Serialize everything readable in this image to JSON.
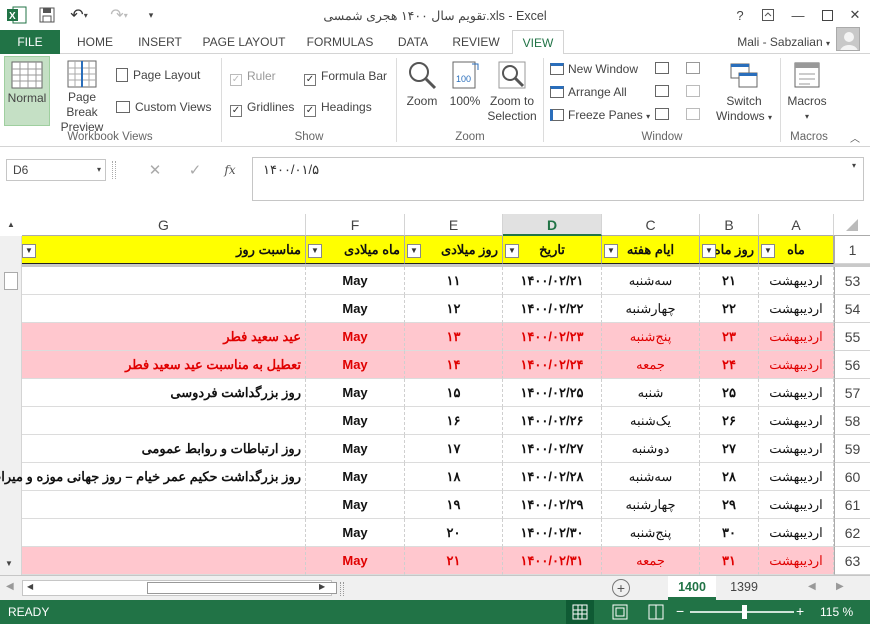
{
  "window": {
    "title": "تقویم سال ۱۴۰۰ هجری شمسی.xls - Excel",
    "help": "?",
    "minimize": "—",
    "close": "✕"
  },
  "tabs": [
    "FILE",
    "HOME",
    "INSERT",
    "PAGE LAYOUT",
    "FORMULAS",
    "DATA",
    "REVIEW",
    "VIEW"
  ],
  "active_tab": "VIEW",
  "user": "Mali - Sabzalian",
  "ribbon": {
    "workbook_views": {
      "group": "Workbook Views",
      "normal": "Normal",
      "page_break_line1": "Page Break",
      "page_break_line2": "Preview",
      "page_layout": "Page Layout",
      "custom_views": "Custom Views"
    },
    "show": {
      "group": "Show",
      "ruler": "Ruler",
      "formula_bar": "Formula Bar",
      "gridlines": "Gridlines",
      "headings": "Headings"
    },
    "zoom": {
      "group": "Zoom",
      "zoom": "Zoom",
      "hundred": "100%",
      "zoom_sel_line1": "Zoom to",
      "zoom_sel_line2": "Selection"
    },
    "window": {
      "group": "Window",
      "new_window": "New Window",
      "arrange_all": "Arrange All",
      "freeze_panes": "Freeze Panes",
      "switch_line1": "Switch",
      "switch_line2": "Windows"
    },
    "macros": {
      "group": "Macros",
      "macros": "Macros"
    }
  },
  "formula_bar": {
    "name_box": "D6",
    "fx": "fx",
    "value": "۱۴۰۰/۰۱/۵"
  },
  "columns": [
    "G",
    "F",
    "E",
    "D",
    "C",
    "B",
    "A"
  ],
  "header_row": {
    "num": "1",
    "A": "ماه",
    "B": "روز ماه",
    "C": "ایام هفته",
    "D": "تاریخ",
    "E": "روز میلادی",
    "F": "ماه میلادی",
    "G": "مناسبت روز"
  },
  "rows": [
    {
      "num": "53",
      "A": "اردیبهشت",
      "B": "۲۱",
      "C": "سه‌شنبه",
      "D": "۱۴۰۰/۰۲/۲۱",
      "E": "۱۱",
      "F": "May",
      "G": "",
      "holiday": false
    },
    {
      "num": "54",
      "A": "اردیبهشت",
      "B": "۲۲",
      "C": "چهارشنبه",
      "D": "۱۴۰۰/۰۲/۲۲",
      "E": "۱۲",
      "F": "May",
      "G": "",
      "holiday": false
    },
    {
      "num": "55",
      "A": "اردیبهشت",
      "B": "۲۳",
      "C": "پنج‌شنبه",
      "D": "۱۴۰۰/۰۲/۲۳",
      "E": "۱۳",
      "F": "May",
      "G": "عید سعید فطر",
      "holiday": true
    },
    {
      "num": "56",
      "A": "اردیبهشت",
      "B": "۲۴",
      "C": "جمعه",
      "D": "۱۴۰۰/۰۲/۲۴",
      "E": "۱۴",
      "F": "May",
      "G": "تعطیل به مناسبت عید سعید فطر",
      "holiday": true
    },
    {
      "num": "57",
      "A": "اردیبهشت",
      "B": "۲۵",
      "C": "شنبه",
      "D": "۱۴۰۰/۰۲/۲۵",
      "E": "۱۵",
      "F": "May",
      "G": "روز بزرگداشت فردوسی",
      "holiday": false
    },
    {
      "num": "58",
      "A": "اردیبهشت",
      "B": "۲۶",
      "C": "یک‌شنبه",
      "D": "۱۴۰۰/۰۲/۲۶",
      "E": "۱۶",
      "F": "May",
      "G": "",
      "holiday": false
    },
    {
      "num": "59",
      "A": "اردیبهشت",
      "B": "۲۷",
      "C": "دوشنبه",
      "D": "۱۴۰۰/۰۲/۲۷",
      "E": "۱۷",
      "F": "May",
      "G": "روز ارتباطات و روابط عمومی",
      "holiday": false
    },
    {
      "num": "60",
      "A": "اردیبهشت",
      "B": "۲۸",
      "C": "سه‌شنبه",
      "D": "۱۴۰۰/۰۲/۲۸",
      "E": "۱۸",
      "F": "May",
      "G": "روز بزرگداشت حکیم عمر خیام – روز جهانی موزه و میراث",
      "holiday": false
    },
    {
      "num": "61",
      "A": "اردیبهشت",
      "B": "۲۹",
      "C": "چهارشنبه",
      "D": "۱۴۰۰/۰۲/۲۹",
      "E": "۱۹",
      "F": "May",
      "G": "",
      "holiday": false
    },
    {
      "num": "62",
      "A": "اردیبهشت",
      "B": "۳۰",
      "C": "پنج‌شنبه",
      "D": "۱۴۰۰/۰۲/۳۰",
      "E": "۲۰",
      "F": "May",
      "G": "",
      "holiday": false
    },
    {
      "num": "63",
      "A": "اردیبهشت",
      "B": "۳۱",
      "C": "جمعه",
      "D": "۱۴۰۰/۰۲/۳۱",
      "E": "۲۱",
      "F": "May",
      "G": "",
      "holiday": true
    }
  ],
  "sheets": [
    "1400",
    "1399"
  ],
  "active_sheet": "1400",
  "status": {
    "ready": "READY",
    "zoom": "115 %"
  },
  "colors": {
    "accent": "#217346",
    "header_fill": "#ffff00",
    "holiday_fill": "#ffc7ce",
    "holiday_text": "#e00000"
  }
}
